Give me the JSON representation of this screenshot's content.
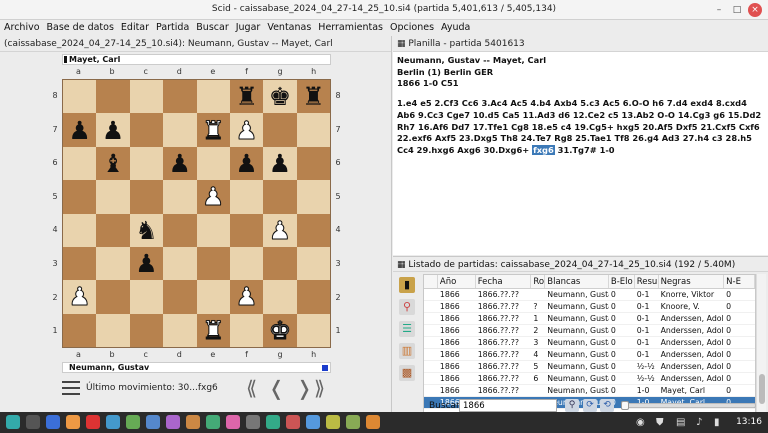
{
  "window": {
    "title": "Scid - caissabase_2024_04_27-14_25_10.si4 (partida 5,401,613 / 5,405,134)"
  },
  "menu": [
    "Archivo",
    "Base de datos",
    "Editar",
    "Partida",
    "Buscar",
    "Jugar",
    "Ventanas",
    "Herramientas",
    "Opciones",
    "Ayuda"
  ],
  "board_pane": {
    "title": "(caissabase_2024_04_27-14_25_10.si4): Neumann, Gustav -- Mayet, Carl",
    "top_player": "Mayet, Carl",
    "bottom_player": "Neumann, Gustav",
    "last_move": "Último movimiento: 30...fxg6",
    "files": [
      "a",
      "b",
      "c",
      "d",
      "e",
      "f",
      "g",
      "h"
    ],
    "ranks": [
      "8",
      "7",
      "6",
      "5",
      "4",
      "3",
      "2",
      "1"
    ],
    "nav": {
      "first": "⟪",
      "prev": "❬",
      "next": "❭",
      "last": "⟫"
    }
  },
  "position": [
    [
      "",
      "",
      "",
      "",
      "",
      "bR",
      "bK",
      "bR"
    ],
    [
      "bP",
      "bP",
      "",
      "",
      "wR",
      "wP",
      "",
      ""
    ],
    [
      "",
      "bB",
      "",
      "bP",
      "",
      "bP",
      "bP",
      ""
    ],
    [
      "",
      "",
      "",
      "",
      "wP",
      "",
      "",
      ""
    ],
    [
      "",
      "",
      "bN",
      "",
      "",
      "",
      "wP",
      ""
    ],
    [
      "",
      "",
      "bP",
      "",
      "",
      "",
      "",
      ""
    ],
    [
      "wP",
      "",
      "",
      "",
      "",
      "wP",
      "",
      ""
    ],
    [
      "",
      "",
      "",
      "",
      "wR",
      "",
      "wK",
      ""
    ]
  ],
  "notation": {
    "title": "Planilla - partida 5401613",
    "header_line1": "Neumann, Gustav  --  Mayet, Carl",
    "header_line2": "Berlin (1)  Berlin GER",
    "header_line3": "1866  1-0  C51",
    "moves_before": "1.e4 e5 2.Cf3 Cc6 3.Ac4 Ac5 4.b4 Axb4 5.c3 Ac5 6.O-O h6 7.d4 exd4 8.cxd4 Ab6 9.Cc3 Cge7 10.d5 Ca5 11.Ad3 d6 12.Ce2 c5 13.Ab2 O-O 14.Cg3 g6 15.Dd2 Rh7 16.Af6 Dd7 17.Tfe1 Cg8 18.e5 c4 19.Cg5+ hxg5 20.Af5 Dxf5 21.Cxf5 Cxf6 22.exf6 Axf5 23.Dxg5 Th8 24.Te7 Rg8 25.Tae1 Tf8 26.g4 Ad3 27.h4 c3 28.h5 Cc4 29.hxg6 Axg6 30.Dxg6+",
    "current_move": "fxg6",
    "moves_after": "31.Tg7# 1-0"
  },
  "game_list": {
    "title": "Listado de partidas: caissabase_2024_04_27-14_25_10.si4 (192 / 5.40M)",
    "columns": [
      "",
      "Año",
      "Fecha",
      "Ron",
      "Blancas",
      "B-Elo",
      "Resu",
      "Negras",
      "N-E"
    ],
    "rows": [
      [
        "",
        "1866",
        "1866.??.??",
        "",
        "Neumann, Gustav",
        "0",
        "0-1",
        "Knorre, Viktor",
        "0"
      ],
      [
        "",
        "1866",
        "1866.??.??",
        "?",
        "Neumann, Gustav",
        "0",
        "0-1",
        "Knoore, V.",
        "0"
      ],
      [
        "",
        "1866",
        "1866.??.??",
        "1",
        "Neumann, Gustav",
        "0",
        "0-1",
        "Anderssen, Adolf",
        "0"
      ],
      [
        "",
        "1866",
        "1866.??.??",
        "2",
        "Neumann, Gustav",
        "0",
        "0-1",
        "Anderssen, Adolf",
        "0"
      ],
      [
        "",
        "1866",
        "1866.??.??",
        "3",
        "Neumann, Gustav",
        "0",
        "0-1",
        "Anderssen, Adolf",
        "0"
      ],
      [
        "",
        "1866",
        "1866.??.??",
        "4",
        "Neumann, Gustav",
        "0",
        "0-1",
        "Anderssen, Adolf",
        "0"
      ],
      [
        "",
        "1866",
        "1866.??.??",
        "5",
        "Neumann, Gustav",
        "0",
        "½-½",
        "Anderssen, Adolf",
        "0"
      ],
      [
        "",
        "1866",
        "1866.??.??",
        "6",
        "Neumann, Gustav",
        "0",
        "½-½",
        "Anderssen, Adolf",
        "0"
      ],
      [
        "",
        "1866",
        "1866.??.??",
        "",
        "Neumann, Gustav",
        "0",
        "1-0",
        "Mayet, Carl",
        "0"
      ],
      [
        "",
        "1866",
        "1866.??.??",
        "",
        "Neumann, Gustav",
        "0",
        "1-0",
        "Mayet, Carl",
        "0"
      ]
    ],
    "selected_index": 9,
    "search_label": "Buscar",
    "search_value": "1866"
  },
  "taskbar": {
    "time": "13:16"
  },
  "colors": {
    "light_square": "#e9d3ad",
    "dark_square": "#b7824e",
    "selection": "#3b78b6"
  }
}
